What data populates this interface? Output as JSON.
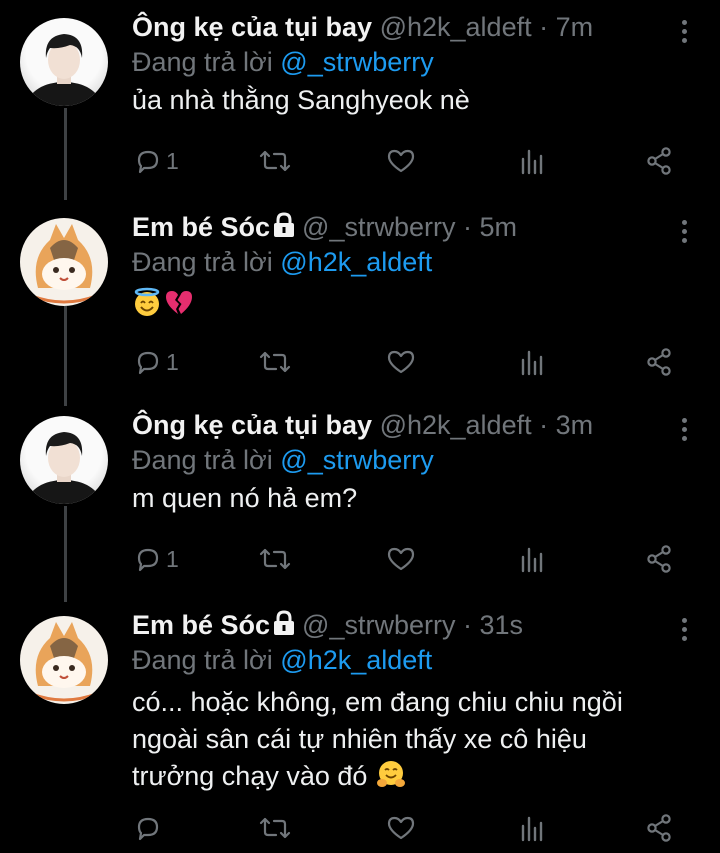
{
  "tweets": [
    {
      "name": "Ông kẹ của tụi bay",
      "handle": "@h2k_aldeft",
      "time": "7m",
      "locked": false,
      "avatar": "person-avatar",
      "reply_prefix": "Đang trả lời",
      "reply_to": "@_strwberry",
      "text": "ủa nhà thằng Sanghyeok nè",
      "reply_count": "1"
    },
    {
      "name": "Em bé Sóc",
      "handle": "@_strwberry",
      "time": "5m",
      "locked": true,
      "avatar": "cat-avatar",
      "reply_prefix": "Đang trả lời",
      "reply_to": "@h2k_aldeft",
      "text": "",
      "emojis": [
        "smiling-face-with-halo-emoji",
        "broken-heart-emoji"
      ],
      "reply_count": "1"
    },
    {
      "name": "Ông kẹ của tụi bay",
      "handle": "@h2k_aldeft",
      "time": "3m",
      "locked": false,
      "avatar": "person-avatar",
      "reply_prefix": "Đang trả lời",
      "reply_to": "@_strwberry",
      "text": "m quen nó hả em?",
      "reply_count": "1"
    },
    {
      "name": "Em bé Sóc",
      "handle": "@_strwberry",
      "time": "31s",
      "locked": true,
      "avatar": "cat-avatar",
      "reply_prefix": "Đang trả lời",
      "reply_to": "@h2k_aldeft",
      "text_lines": [
        "có... hoặc không, em đang chiu chiu ngồi",
        "ngoài sân cái tự nhiên thấy xe cô hiệu",
        "trưởng chạy vào đó"
      ],
      "trailing_emoji": "hugging-face-emoji",
      "reply_count": ""
    }
  ],
  "separator": "·",
  "colors": {
    "background": "#000000",
    "muted": "#71767b",
    "link": "#1d9bf0",
    "thread_line": "#3e4144"
  },
  "icons": [
    "reply-icon",
    "retweet-icon",
    "like-icon",
    "analytics-icon",
    "share-icon",
    "more-icon",
    "lock-icon"
  ]
}
